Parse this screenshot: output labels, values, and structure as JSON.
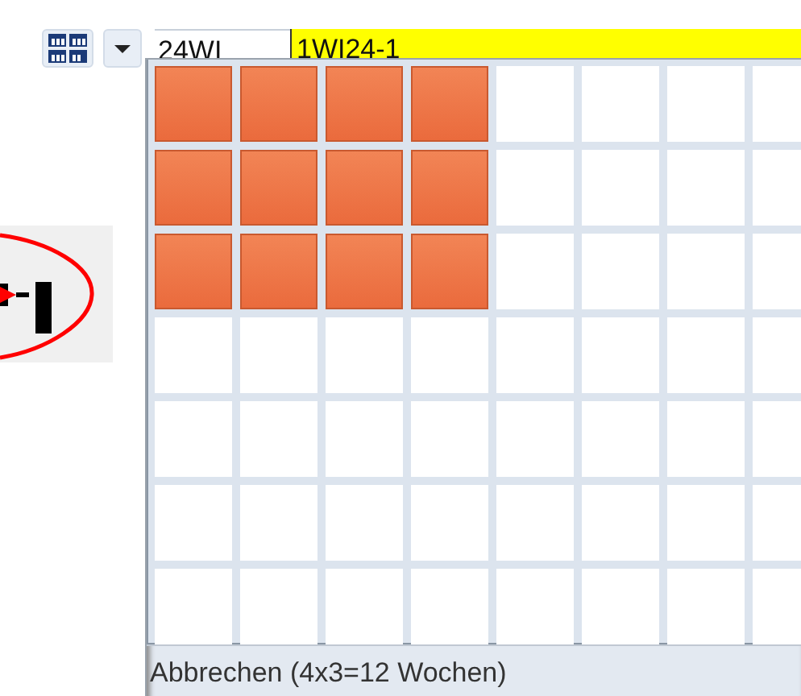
{
  "toolbar": {
    "period_field": {
      "value": "24WI"
    },
    "code_field": {
      "value": "1WI24-1"
    }
  },
  "week_grid": {
    "rows": [
      {
        "cells": [
          {
            "selected": true
          },
          {
            "selected": true
          },
          {
            "selected": true
          },
          {
            "selected": true
          },
          {
            "selected": false
          },
          {
            "selected": false
          },
          {
            "selected": false
          },
          {
            "selected": false
          }
        ]
      },
      {
        "cells": [
          {
            "selected": true
          },
          {
            "selected": true
          },
          {
            "selected": true
          },
          {
            "selected": true
          },
          {
            "selected": false
          },
          {
            "selected": false
          },
          {
            "selected": false
          },
          {
            "selected": false
          }
        ]
      },
      {
        "cells": [
          {
            "selected": true
          },
          {
            "selected": true
          },
          {
            "selected": true
          },
          {
            "selected": true
          },
          {
            "selected": false
          },
          {
            "selected": false
          },
          {
            "selected": false
          },
          {
            "selected": false
          }
        ]
      },
      {
        "cells": [
          {
            "selected": false
          },
          {
            "selected": false
          },
          {
            "selected": false
          },
          {
            "selected": false
          },
          {
            "selected": false
          },
          {
            "selected": false
          },
          {
            "selected": false
          },
          {
            "selected": false
          }
        ]
      },
      {
        "cells": [
          {
            "selected": false
          },
          {
            "selected": false
          },
          {
            "selected": false
          },
          {
            "selected": false
          },
          {
            "selected": false
          },
          {
            "selected": false
          },
          {
            "selected": false
          },
          {
            "selected": false
          }
        ]
      },
      {
        "cells": [
          {
            "selected": false
          },
          {
            "selected": false
          },
          {
            "selected": false
          },
          {
            "selected": false
          },
          {
            "selected": false
          },
          {
            "selected": false
          },
          {
            "selected": false
          },
          {
            "selected": false
          }
        ]
      },
      {
        "cells": [
          {
            "selected": false
          },
          {
            "selected": false
          },
          {
            "selected": false
          },
          {
            "selected": false
          },
          {
            "selected": false
          },
          {
            "selected": false
          },
          {
            "selected": false
          },
          {
            "selected": false
          }
        ]
      }
    ],
    "status": "Abbrechen (4x3=12 Wochen)"
  }
}
